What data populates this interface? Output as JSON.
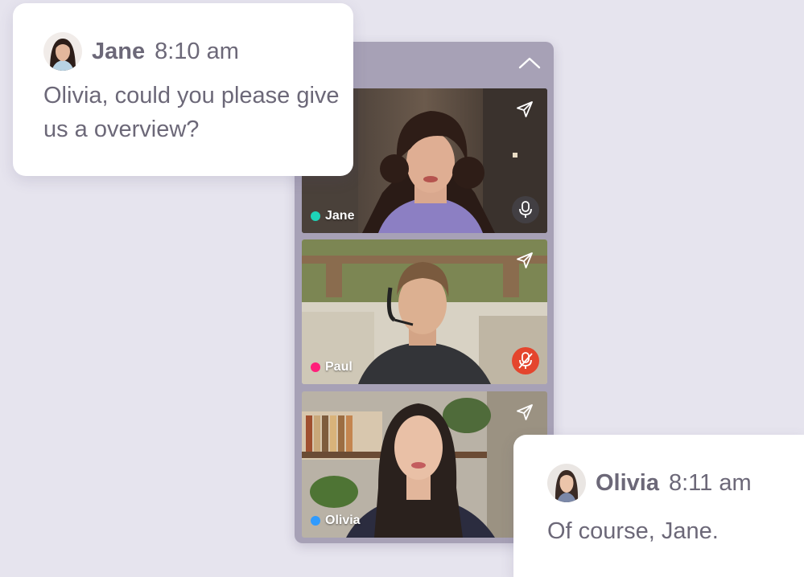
{
  "participants": [
    {
      "name": "Jane",
      "dot_color": "#1ed3b8",
      "mic": "on"
    },
    {
      "name": "Paul",
      "dot_color": "#ff1f7a",
      "mic": "muted"
    },
    {
      "name": "Olivia",
      "dot_color": "#2f9bff",
      "mic": "none"
    }
  ],
  "messages": [
    {
      "sender": "Jane",
      "time": "8:10 am",
      "text": "Olivia, could you please give us a overview?"
    },
    {
      "sender": "Olivia",
      "time": "8:11 am",
      "text": "Of course, Jane."
    }
  ],
  "icons": {
    "collapse": "chevron-up-icon",
    "send": "send-icon",
    "mic_on": "microphone-icon",
    "mic_off": "microphone-off-icon"
  }
}
